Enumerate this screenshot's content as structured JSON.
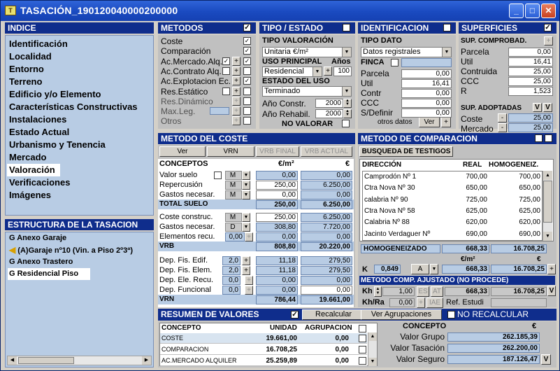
{
  "window": {
    "title": "TASACIÓN_190120040000200000"
  },
  "indice": {
    "title": "INDICE",
    "items": [
      "Identificación",
      "Localidad",
      "Entorno",
      "Terreno",
      "Edificio y/o Elemento",
      "Características Constructivas",
      "Instalaciones",
      "Estado Actual",
      "Urbanismo y Tenencia",
      "Mercado",
      "Valoración",
      "Verificaciones",
      "Imágenes"
    ]
  },
  "estructura": {
    "title": "ESTRUCTURA DE LA TASACION",
    "items": [
      "G Anexo Garaje",
      "(A)Garaje  nº10 (Vin. a Piso 2º3ª)",
      "G Anexo Trastero",
      "G Residencial Piso"
    ]
  },
  "metodos": {
    "title": "METODOS",
    "rows": [
      "Coste",
      "Comparación",
      "Ac.Mercado.Alq.",
      "Ac.Contrato Alq.",
      "Ac.Explotacion Ec.",
      "Res.Estático",
      "Res.Dinámico",
      "Max.Leg.",
      "Otros"
    ]
  },
  "tipo": {
    "title": "TIPO / ESTADO",
    "valoracion_label": "TIPO VALORACIÓN",
    "valoracion": "Unitaria €/m²",
    "uso_label": "USO PRINCIPAL",
    "anos_label": "Años",
    "uso": "Residencial",
    "anos": "100",
    "estado_label": "ESTADO DEL USO",
    "estado": "Terminado",
    "ano_const_label": "Año Constr.",
    "ano_const": "2000",
    "ano_rehab_label": "Año Rehabil.",
    "ano_rehab": "2000",
    "no_valorar": "NO VALORAR"
  },
  "ident": {
    "title": "IDENTIFICACION",
    "tipo_dato_label": "TIPO DATO",
    "tipo_dato": "Datos registrales",
    "finca": "FINCA",
    "rows": [
      {
        "l": "Parcela",
        "v": "0,00"
      },
      {
        "l": "Util",
        "v": "16,41"
      },
      {
        "l": "Contr",
        "v": "0,00"
      },
      {
        "l": "CCC",
        "v": "0,00"
      },
      {
        "l": "S/Definir",
        "v": "0,00"
      }
    ],
    "otros": "otros datos",
    "ver": "Ver"
  },
  "superficies": {
    "title": "SUPERFICIES",
    "comprob": "SUP. COMPROBAD.",
    "rows": [
      {
        "l": "Parcela",
        "v": "0,00"
      },
      {
        "l": "Util",
        "v": "16,41"
      },
      {
        "l": "Contruida",
        "v": "25,00"
      },
      {
        "l": "CCC",
        "v": "25,00"
      },
      {
        "l": "R",
        "v": "1,523"
      }
    ],
    "adoptadas": "SUP. ADOPTADAS",
    "coste_l": "Coste",
    "coste": "25,00",
    "mercado_l": "Mercado",
    "mercado": "25,00"
  },
  "coste": {
    "title": "METODO DEL COSTE",
    "buttons": [
      "Ver",
      "VRN",
      "VRB FINAL",
      "VRB ACTUAL"
    ],
    "h_conceptos": "CONCEPTOS",
    "h_m2": "€/m²",
    "h_eur": "€",
    "rows": [
      {
        "l": "Valor suelo",
        "m": "M",
        "a": "0,00",
        "b": "0,00"
      },
      {
        "l": "Repercusión",
        "m": "M",
        "a": "250,00",
        "b": "6.250,00"
      },
      {
        "l": "Gastos necesar.",
        "m": "M",
        "a": "0,00",
        "b": "0,00"
      },
      {
        "l": "TOTAL SUELO",
        "m": "",
        "a": "250,00",
        "b": "6.250,00"
      },
      {
        "l": "Coste construc.",
        "m": "M",
        "a": "250,00",
        "b": "6.250,00"
      },
      {
        "l": "Gastos necesar.",
        "m": "D",
        "a": "308,80",
        "b": "7.720,00"
      },
      {
        "l": "Elementos recu.",
        "m": "0,00",
        "a": "0,00",
        "b": "0,00"
      },
      {
        "l": "VRB",
        "m": "",
        "a": "808,80",
        "b": "20.220,00"
      },
      {
        "l": "Dep. Fis. Edif.",
        "m": "2,0",
        "a": "11,18",
        "b": "279,50"
      },
      {
        "l": "Dep. Fis. Elem.",
        "m": "2,0",
        "a": "11,18",
        "b": "279,50"
      },
      {
        "l": "Dep. Ele. Recu.",
        "m": "0,0",
        "a": "0,00",
        "b": "0,00"
      },
      {
        "l": "Dep. Funcional",
        "m": "0,0",
        "a": "0,00",
        "b": "0,00"
      },
      {
        "l": "VRN",
        "m": "",
        "a": "786,44",
        "b": "19.661,00"
      }
    ]
  },
  "comparacion": {
    "title": "METODO DE COMPARACION",
    "busqueda": "BUSQUEDA DE TESTIGOS",
    "h_dir": "DIRECCIÓN",
    "h_real": "REAL",
    "h_homog": "HOMOGENEIZ.",
    "rows": [
      {
        "d": "Camprodón Nº 1",
        "r": "700,00",
        "h": "700,00"
      },
      {
        "d": "Ctra Nova Nº 30",
        "r": "650,00",
        "h": "650,00"
      },
      {
        "d": "calabria Nº 90",
        "r": "725,00",
        "h": "725,00"
      },
      {
        "d": "Ctra Nova Nº 58",
        "r": "625,00",
        "h": "625,00"
      },
      {
        "d": "Calabria Nº 88",
        "r": "620,00",
        "h": "620,00"
      },
      {
        "d": "Jacinto Verdaguer Nº",
        "r": "690,00",
        "h": "690,00"
      }
    ],
    "homog_label": "HOMOGENEIZADO",
    "homog_m2": "668,33",
    "homog_eur": "16.708,25",
    "h2_m2": "€/m²",
    "h2_eur": "€",
    "k_label": "K",
    "k": "0,849",
    "a": "A",
    "k_m2": "668,33",
    "k_eur": "16.708,25",
    "ajust_title": "METODO COMP. AJUSTADO (NO PROCEDE)",
    "kh": "Kh",
    "kh_v": "1,00",
    "es": "ES",
    "at": "AT",
    "aj_m2": "668,33",
    "aj_eur": "16.708,25",
    "v": "V",
    "khra": "Kh/Ra",
    "khra_v": "0,00",
    "iae": "IAE",
    "ref": "Ref. Estudi"
  },
  "resumen": {
    "title": "RESUMEN DE VALORES",
    "recalcular": "Recalcular",
    "ver_agrup": "Ver Agrupaciones",
    "no_recalc": "NO RECALCULAR",
    "h_concepto": "CONCEPTO",
    "h_unidad": "UNIDAD",
    "h_agrup": "AGRUPACION",
    "rows": [
      {
        "c": "COSTE",
        "u": "19.661,00",
        "g": "0,00"
      },
      {
        "c": "COMPARACION",
        "u": "16.708,25",
        "g": "0,00"
      },
      {
        "c": "AC.MERCADO ALQUILER",
        "u": "25.259,89",
        "g": "0,00"
      }
    ],
    "h2_concepto": "CONCEPTO",
    "h2_eur": "€",
    "vg_l": "Valor Grupo",
    "vg": "262.185,39",
    "vt_l": "Valor Tasación",
    "vt": "262.200,00",
    "vs_l": "Valor Seguro",
    "vs": "187.126,47",
    "v": "V"
  }
}
